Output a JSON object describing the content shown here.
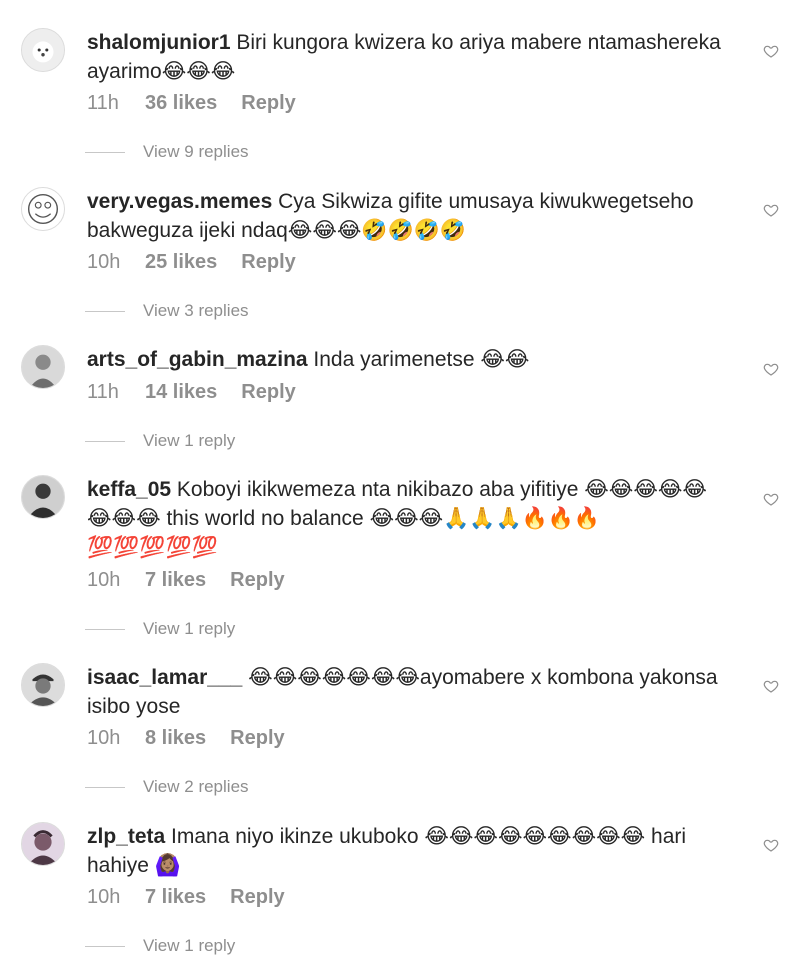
{
  "comments": [
    {
      "username": "shalomjunior1",
      "text": "Biri kungora kwizera ko ariya mabere ntamashereka ayarimo😂😂😂",
      "time": "11h",
      "likes": "36 likes",
      "reply": "Reply",
      "view_replies": "View 9 replies"
    },
    {
      "username": "very.vegas.memes",
      "text": "Cya Sikwiza gifite umusaya kiwukwegetseho bakweguza ijeki ndaq😂😂😂🤣🤣🤣🤣",
      "time": "10h",
      "likes": "25 likes",
      "reply": "Reply",
      "view_replies": "View 3 replies"
    },
    {
      "username": "arts_of_gabin_mazina",
      "text": "Inda yarimenetse 😂😂",
      "time": "11h",
      "likes": "14 likes",
      "reply": "Reply",
      "view_replies": "View 1 reply"
    },
    {
      "username": "keffa_05",
      "text": "Koboyi ikikwemeza nta nikibazo aba yifitiye 😂😂😂😂😂😂😂😂 this world no balance 😂😂😂🙏🙏🙏🔥🔥🔥💯💯💯💯💯",
      "time": "10h",
      "likes": "7 likes",
      "reply": "Reply",
      "view_replies": "View 1 reply"
    },
    {
      "username": "isaac_lamar___",
      "text": "😂😂😂😂😂😂😂ayomabere x kombona yakonsa isibo yose",
      "time": "10h",
      "likes": "8 likes",
      "reply": "Reply",
      "view_replies": "View 2 replies"
    },
    {
      "username": "zlp_teta",
      "text": "Imana niyo ikinze ukuboko 😂😂😂😂😂😂😂😂😂 hari hahiye 🙆🏽‍♀️",
      "time": "10h",
      "likes": "7 likes",
      "reply": "Reply",
      "view_replies": "View 1 reply"
    }
  ],
  "icons": {
    "like": "heart-outline-icon"
  },
  "colors": {
    "primary_text": "#262626",
    "secondary_text": "#8e8e8e"
  }
}
